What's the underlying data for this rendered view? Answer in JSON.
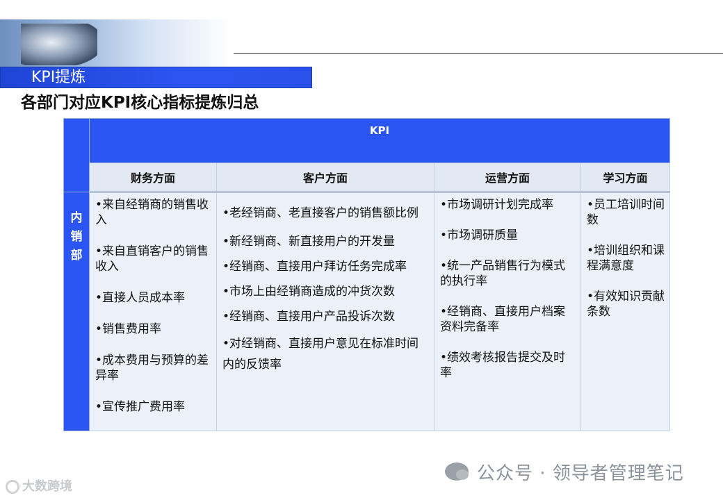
{
  "header": {
    "section_title": "KPI提炼",
    "subtitle": "各部门对应KPI核心指标提炼归总"
  },
  "table": {
    "kpi_header": "KPI",
    "columns": [
      "财务方面",
      "客户方面",
      "运营方面",
      "学习方面"
    ],
    "row_label": "内\n销\n部",
    "row_label_chars": [
      "内",
      "销",
      "部"
    ],
    "finance": [
      "•来自经销商的销售收入",
      "•来自直销客户的销售收入",
      "•直接人员成本率",
      "•销售费用率",
      "•成本费用与预算的差异率",
      "•宣传推广费用率"
    ],
    "customer": [
      "•老经销商、老直接客户的销售额比例",
      "•新经销商、新直接用户的开发量",
      "•经销商、直接用户拜访任务完成率",
      "•市场上由经销商造成的冲货次数",
      "•经销商、直接用户产品投诉次数",
      "•对经销商、直接用户意见在标准时间内的反馈率"
    ],
    "operations": [
      "•市场调研计划完成率",
      "•市场调研质量",
      "•统一产品销售行为模式的执行率",
      "•经销商、直接用户档案资料完备率",
      "•绩效考核报告提交及时率"
    ],
    "learning": [
      "•员工培训时间数",
      "•培训组织和课程满意度",
      "•有效知识贡献条数"
    ]
  },
  "watermarks": {
    "right": "公众号 · 领导者管理笔记",
    "left": "大数跨境"
  }
}
